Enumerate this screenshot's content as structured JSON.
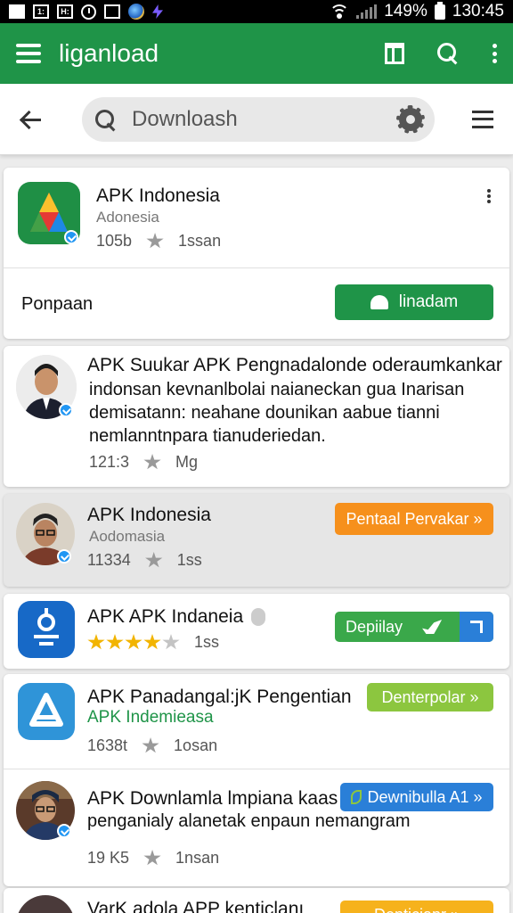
{
  "status_bar": {
    "battery": "149%",
    "time": "130:45",
    "box1": "",
    "box2": "1:",
    "box3": "H:"
  },
  "app_bar": {
    "title": "liganload"
  },
  "search": {
    "value": "Downloash"
  },
  "cards": [
    {
      "title": "APK Indonesia",
      "subtitle": "Adonesia",
      "count": "105b",
      "rating_text": "1ssan",
      "action_label": "Ponpaan",
      "button": "linadam"
    },
    {
      "title": "APK Suukar APK Pengnadalonde oderaumkankar",
      "desc_lines": [
        "indonsan kevnanlbolai naianeckan gua Inarisan",
        "demisatann: neahane dounikan aabue tianni",
        "nemlanntnpara tianuderiedan."
      ],
      "count": "121:3",
      "rating_text": "Mg"
    },
    {
      "title": "APK Indonesia",
      "subtitle": "Aodomasia",
      "count": "11334",
      "rating_text": "1ss",
      "button": "Pentaal Pervakar »"
    },
    {
      "title": "APK APK Indaneia",
      "rating": 4,
      "rating_text": "1ss",
      "button": "Depiilay"
    },
    {
      "title": "APK Panadangal:jK Pengentian",
      "subtitle": "APK Indemieasa",
      "count": "1638t",
      "rating_text": "1osan",
      "button": "Denterpolar »"
    },
    {
      "title": "APK Downlamla lmpiana kaas",
      "desc": "penganialy alanetak enpaun nemangram",
      "count": "19 K5",
      "rating_text": "1nsan",
      "button": "Dewnibulla A1 »"
    },
    {
      "title": "VarK adola APP kenticlanı",
      "button": "Denticiapr »"
    }
  ],
  "colors": {
    "primary": "#1f9448",
    "orange": "#f6901c",
    "blue": "#2a7fd8",
    "lime": "#8cc63f",
    "green_btn": "#3aa84a"
  }
}
